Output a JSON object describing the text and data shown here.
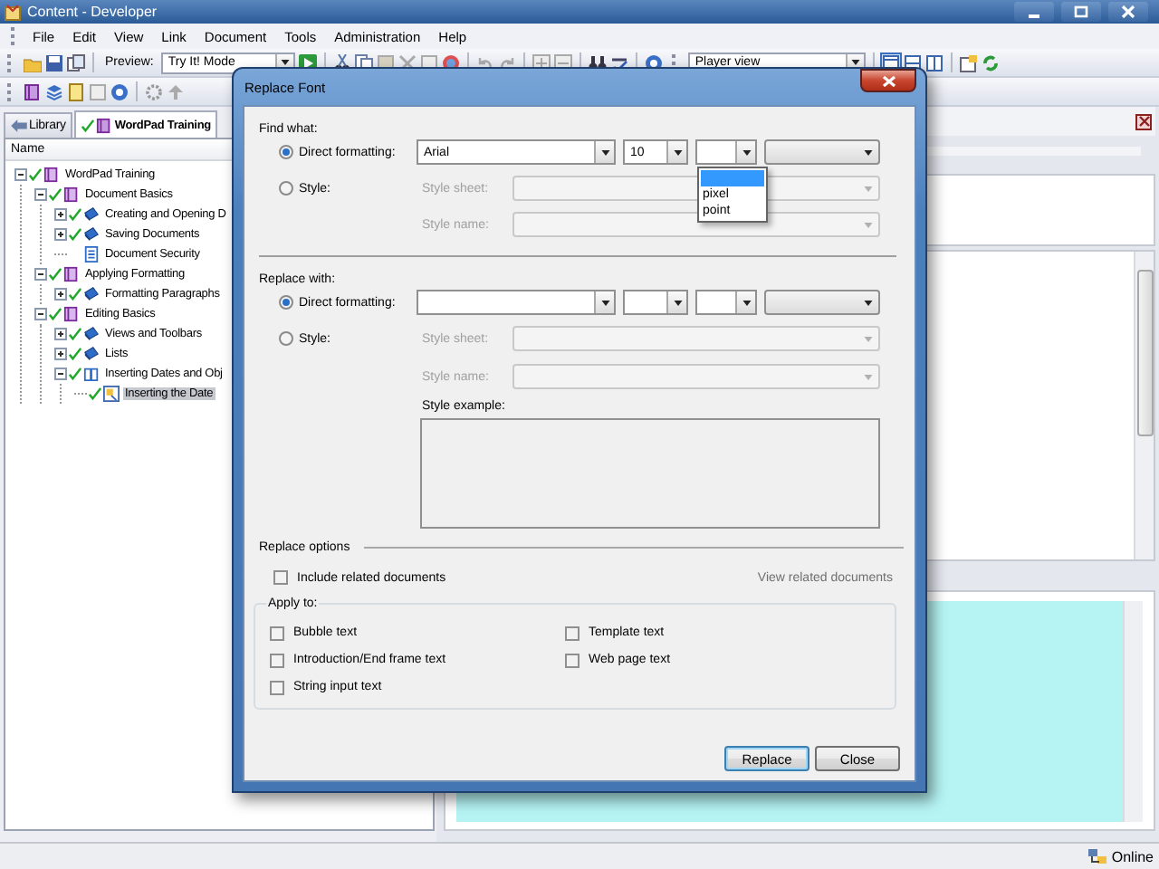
{
  "window": {
    "title": "Content - Developer"
  },
  "menu": [
    "File",
    "Edit",
    "View",
    "Link",
    "Document",
    "Tools",
    "Administration",
    "Help"
  ],
  "toolbar": {
    "preview_label": "Preview:",
    "preview_mode": "Try It! Mode",
    "view_mode": "Player view"
  },
  "tabs": [
    {
      "label": "Library",
      "selected": false
    },
    {
      "label": "WordPad Training",
      "selected": true
    }
  ],
  "tree": {
    "header": "Name",
    "items": [
      {
        "label": "WordPad Training",
        "kind": "book",
        "checked": true,
        "expanded": true,
        "selected": false,
        "children": [
          {
            "label": "Document Basics",
            "kind": "book",
            "checked": true,
            "expanded": true,
            "selected": false,
            "children": [
              {
                "label": "Creating and Opening D",
                "kind": "module",
                "checked": true,
                "expanded": false,
                "selected": false
              },
              {
                "label": "Saving Documents",
                "kind": "module",
                "checked": true,
                "expanded": false,
                "selected": false
              },
              {
                "label": "Document Security",
                "kind": "document",
                "checked": false,
                "selected": false
              }
            ]
          },
          {
            "label": "Applying Formatting",
            "kind": "book",
            "checked": true,
            "expanded": true,
            "selected": false,
            "children": [
              {
                "label": "Formatting Paragraphs",
                "kind": "module",
                "checked": true,
                "expanded": false,
                "selected": false
              }
            ]
          },
          {
            "label": "Editing Basics",
            "kind": "book",
            "checked": true,
            "expanded": true,
            "selected": false,
            "children": [
              {
                "label": "Views and Toolbars",
                "kind": "module",
                "checked": true,
                "expanded": false,
                "selected": false
              },
              {
                "label": "Lists",
                "kind": "module",
                "checked": true,
                "expanded": false,
                "selected": false
              },
              {
                "label": "Inserting Dates and Obj",
                "kind": "module",
                "checked": true,
                "expanded": true,
                "selected": false,
                "children": [
                  {
                    "label": "Inserting the Date",
                    "kind": "topic",
                    "checked": true,
                    "selected": true
                  }
                ]
              }
            ]
          }
        ]
      }
    ]
  },
  "dialog": {
    "title": "Replace Font",
    "sections": [
      {
        "heading": "Find what:",
        "options": [
          {
            "kind": "direct",
            "label": "Direct formatting:",
            "selected": true
          },
          {
            "kind": "style",
            "label": "Style:",
            "selected": false
          }
        ],
        "font": "Arial",
        "size": "10",
        "style_sheet_label": "Style sheet:",
        "style_name_label": "Style name:"
      },
      {
        "heading": "Replace with:",
        "options": [
          {
            "kind": "direct",
            "label": "Direct formatting:",
            "selected": true
          },
          {
            "kind": "style",
            "label": "Style:",
            "selected": false
          }
        ],
        "style_sheet_label": "Style sheet:",
        "style_name_label": "Style name:",
        "style_example_label": "Style example:"
      }
    ],
    "unit_list": {
      "blank_selected": true,
      "options": [
        {
          "label": "pixel",
          "selected": false
        },
        {
          "label": "point",
          "selected": false
        }
      ]
    },
    "options_heading": "Replace options",
    "include_related": {
      "label": "Include related documents",
      "checked": false
    },
    "view_related": {
      "label": "View related documents",
      "disabled": true
    },
    "apply_to": {
      "legend": "Apply to:",
      "items": [
        {
          "label": "Bubble text",
          "checked": false
        },
        {
          "label": "Template text",
          "checked": false
        },
        {
          "label": "Introduction/End frame text",
          "checked": false
        },
        {
          "label": "Web page text",
          "checked": false
        },
        {
          "label": "String input text",
          "checked": false
        }
      ]
    },
    "buttons": [
      {
        "label": "Replace",
        "default": true
      },
      {
        "label": "Close",
        "default": false
      }
    ]
  },
  "status_bar": {
    "connection": "Online"
  }
}
